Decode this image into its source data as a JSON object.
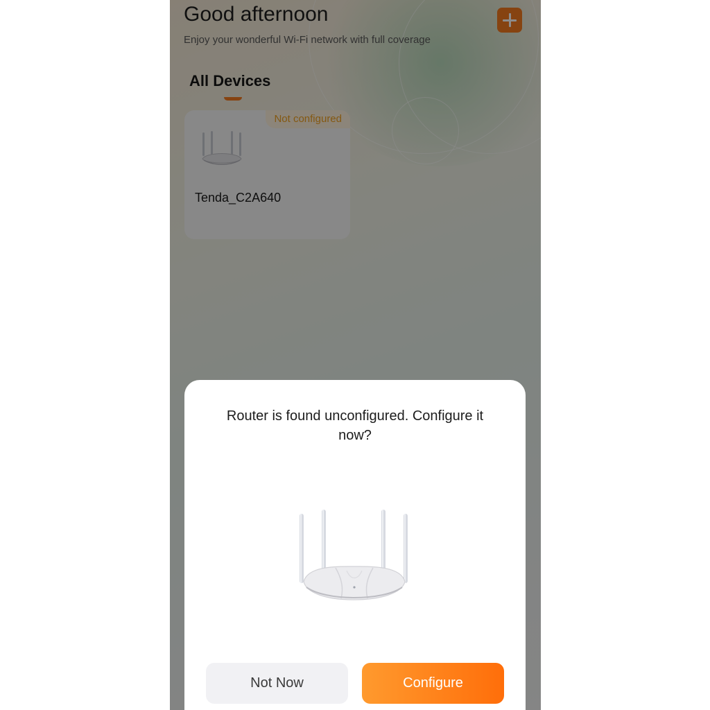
{
  "home": {
    "greeting": "Good afternoon",
    "subtitle": "Enjoy your wonderful Wi-Fi network with full coverage",
    "add_icon": "plus-icon"
  },
  "tabs": [
    {
      "label": "All Devices",
      "selected": true
    }
  ],
  "devices": [
    {
      "name": "Tenda_C2A640",
      "status": "Not configured",
      "icon": "router-icon"
    }
  ],
  "dialog": {
    "message": "Router is found unconfigured. Configure it now?",
    "image": "router-icon",
    "secondary_label": "Not Now",
    "primary_label": "Configure"
  },
  "colors": {
    "accent": "#f47a1f",
    "status_badge": "#f0a020",
    "button_gradient_start": "#ff9a2e",
    "button_gradient_end": "#ff6e0a"
  }
}
